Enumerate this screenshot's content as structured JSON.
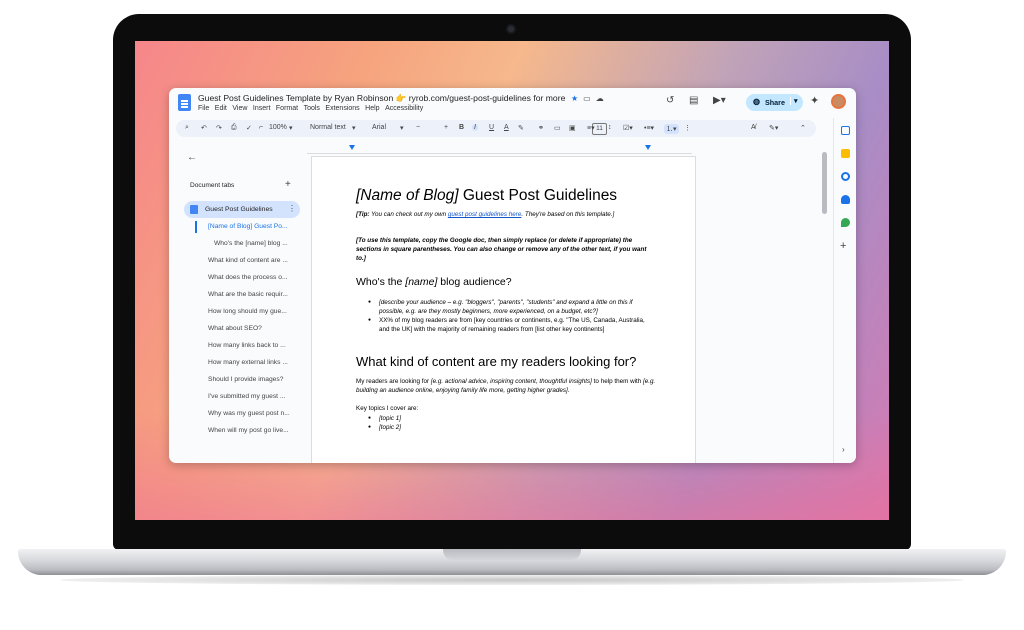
{
  "window": {
    "doc_title": "Guest Post Guidelines Template by Ryan Robinson 👉 ryrob.com/guest-post-guidelines for more",
    "menu": [
      "File",
      "Edit",
      "View",
      "Insert",
      "Format",
      "Tools",
      "Extensions",
      "Help",
      "Accessibility"
    ],
    "share_label": "Share"
  },
  "toolbar": {
    "zoom": "100%",
    "style": "Normal text",
    "font": "Arial",
    "font_size": "11",
    "bold": "B",
    "italic": "I",
    "underline": "U",
    "text_color": "A"
  },
  "sidebar": {
    "tabs_label": "Document tabs",
    "active_tab": "Guest Post Guidelines",
    "outline": [
      "[Name of Blog] Guest Po...",
      "Who's the [name] blog ...",
      "What kind of content are ...",
      "What does the process o...",
      "What are the basic requir...",
      "How long should my gue...",
      "What about SEO?",
      "How many links back to ...",
      "How many external links ...",
      "Should I provide images?",
      "I've submitted my guest ...",
      "Why was my guest post n...",
      "When will my post go live..."
    ]
  },
  "document": {
    "title_bracket": "[Name of Blog]",
    "title_rest": " Guest Post Guidelines",
    "tip_prefix": "[Tip:",
    "tip_text": " You can check out my own ",
    "tip_link": "guest post guidelines here",
    "tip_suffix": ". They're based on this template.]",
    "instructions": "[To use this template, copy the Google doc, then simply replace (or delete if appropriate) the sections in square parentheses. You can also change or remove any of the other text, if you want to.]",
    "h_audience_pre": "Who's the ",
    "h_audience_name": "[name]",
    "h_audience_post": " blog audience?",
    "audience_bullets": [
      "[describe your audience – e.g. \"bloggers\", \"parents\", \"students\" and expand a little on this if possible, e.g. are they mostly beginners, more experienced, on a budget, etc?]",
      "XX% of my blog readers are from [key countries or continents, e.g. \"The US, Canada, Australia, and the UK] with the majority of remaining readers from [list other key continents]"
    ],
    "h_content": "What kind of content are my readers looking for?",
    "content_para_pre": "My readers are looking for ",
    "content_para_ital1": "[e.g. actional advice, inspiring content, thoughtful insights]",
    "content_para_mid": " to help them with ",
    "content_para_ital2": "[e.g. building an audience online, enjoying family life more, getting higher grades]",
    "content_para_end": ".",
    "topics_label": "Key topics I cover are:",
    "topics": [
      "[topic 1]",
      "[topic 2]"
    ]
  },
  "colors": {
    "accent": "#1a73e8",
    "share_bg": "#c2e7ff",
    "active_tab_bg": "#d3e3fd",
    "toolbar_bg": "#edf2fa"
  }
}
